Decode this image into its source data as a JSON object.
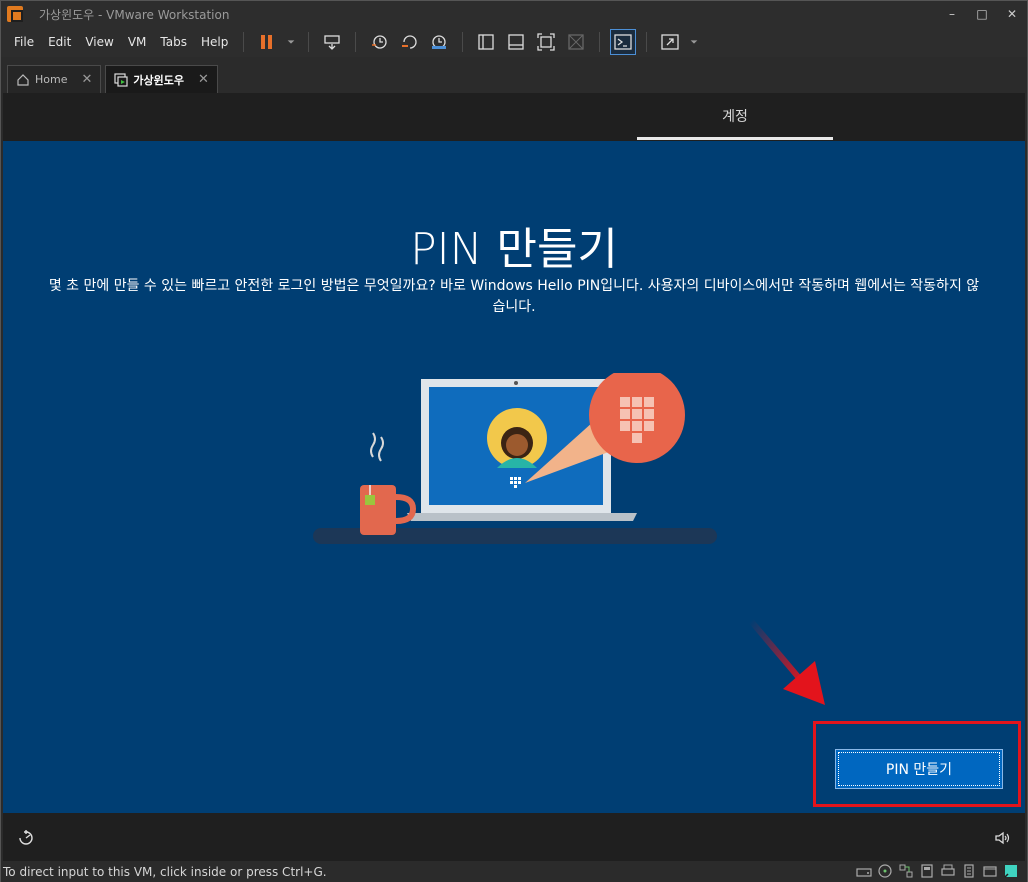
{
  "window": {
    "title": "가상윈도우 - VMware Workstation",
    "controls": [
      "–",
      "□",
      "✕"
    ]
  },
  "menu": {
    "items": [
      "File",
      "Edit",
      "View",
      "VM",
      "Tabs",
      "Help"
    ]
  },
  "tabs": [
    {
      "label": "Home",
      "icon": "home-icon"
    },
    {
      "label": "가상윈도우",
      "icon": "vm-icon"
    }
  ],
  "vm": {
    "top_tab": "계정",
    "title": "PIN 만들기",
    "description": "몇 초 만에 만들 수 있는 빠르고 안전한 로그인 방법은 무엇일까요? 바로 Windows Hello PIN입니다. 사용자의 디바이스에서만 작동하며 웹에서는 작동하지 않습니다.",
    "button_label": "PIN 만들기"
  },
  "status": {
    "text": "To direct input to this VM, click inside or press Ctrl+G."
  },
  "colors": {
    "oobe_bg": "#003e73",
    "button_bg": "#0067c0",
    "highlight": "#e3141c",
    "accent_orange": "#e8702a"
  }
}
